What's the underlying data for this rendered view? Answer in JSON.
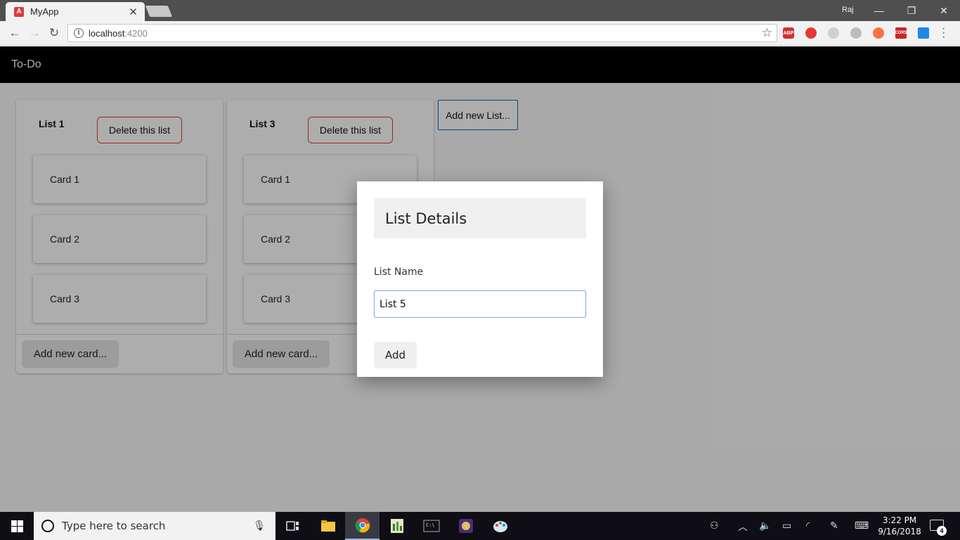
{
  "browser": {
    "tab_title": "MyApp",
    "tab_favicon": "A",
    "url_host": "localhost",
    "url_port": ":4200",
    "user": "Raj",
    "extensions": [
      "ABP",
      "CORS"
    ]
  },
  "app": {
    "title": "To-Do",
    "add_list_label": "Add new List...",
    "lists": [
      {
        "title": "List 1",
        "delete_label": "Delete this list",
        "cards": [
          "Card 1",
          "Card 2",
          "Card 3"
        ],
        "add_card_label": "Add new card..."
      },
      {
        "title": "List 3",
        "delete_label": "Delete this list",
        "cards": [
          "Card 1",
          "Card 2",
          "Card 3"
        ],
        "add_card_label": "Add new card..."
      }
    ]
  },
  "dialog": {
    "title": "List Details",
    "field_label": "List Name",
    "field_value": "List 5",
    "submit_label": "Add"
  },
  "taskbar": {
    "search_placeholder": "Type here to search",
    "time": "3:22 PM",
    "date": "9/16/2018",
    "notification_count": "4"
  },
  "colors": {
    "header_bg": "#000000",
    "delete_border": "#e53935",
    "add_list_border": "#1565c0",
    "input_focus_border": "#7aa6e0"
  }
}
